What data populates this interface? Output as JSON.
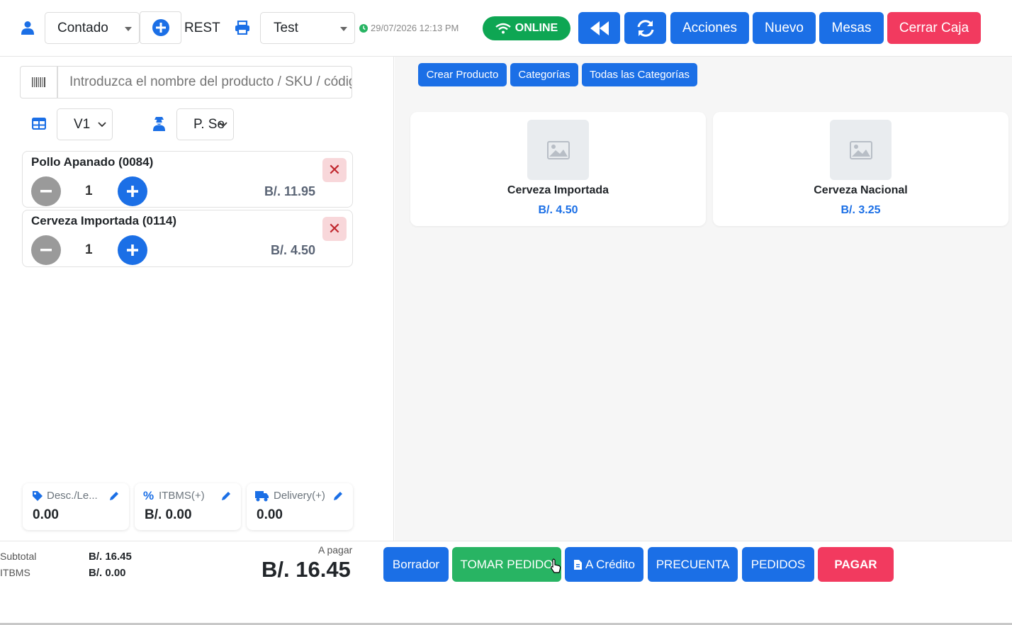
{
  "header": {
    "customer_select": "Contado",
    "rest_label": "REST",
    "printer_select": "Test",
    "datetime": "29/07/2026 12:13 PM",
    "status": "ONLINE",
    "buttons": {
      "acciones": "Acciones",
      "nuevo": "Nuevo",
      "mesas": "Mesas",
      "cerrar_caja": "Cerrar Caja"
    }
  },
  "search": {
    "placeholder": "Introduzca el nombre del producto / SKU / código"
  },
  "filters": {
    "table_select": "V1",
    "waiter_select": "P. Se"
  },
  "cart": {
    "items": [
      {
        "name": "Pollo Apanado (0084)",
        "qty": "1",
        "price": "B/. 11.95"
      },
      {
        "name": "Cerveza Importada (0114)",
        "qty": "1",
        "price": "B/. 4.50"
      }
    ]
  },
  "fees": {
    "discount": {
      "label": "Desc./Le...",
      "value": "0.00"
    },
    "itbms": {
      "label": "ITBMS(+)",
      "value": "B/. 0.00"
    },
    "delivery": {
      "label": "Delivery(+)",
      "value": "0.00"
    }
  },
  "totals": {
    "subtotal_label": "Subtotal",
    "subtotal_value": "B/. 16.45",
    "itbms_label": "ITBMS",
    "itbms_value": "B/. 0.00",
    "apagar_label": "A pagar",
    "apagar_value": "B/. 16.45"
  },
  "catalog": {
    "buttons": {
      "crear_producto": "Crear Producto",
      "categorias": "Categorías",
      "todas": "Todas las Categorías"
    },
    "products": [
      {
        "name": "Cerveza Importada",
        "price": "B/. 4.50"
      },
      {
        "name": "Cerveza Nacional",
        "price": "B/. 3.25"
      }
    ]
  },
  "actions": {
    "borrador": "Borrador",
    "tomar_pedido": "TOMAR PEDIDO",
    "a_credito": "A Crédito",
    "precuenta": "PRECUENTA",
    "pedidos": "PEDIDOS",
    "pagar": "PAGAR"
  },
  "colors": {
    "primary": "#1b6fe6",
    "danger": "#f23a5f",
    "success": "#28b463",
    "online": "#0ea653"
  }
}
